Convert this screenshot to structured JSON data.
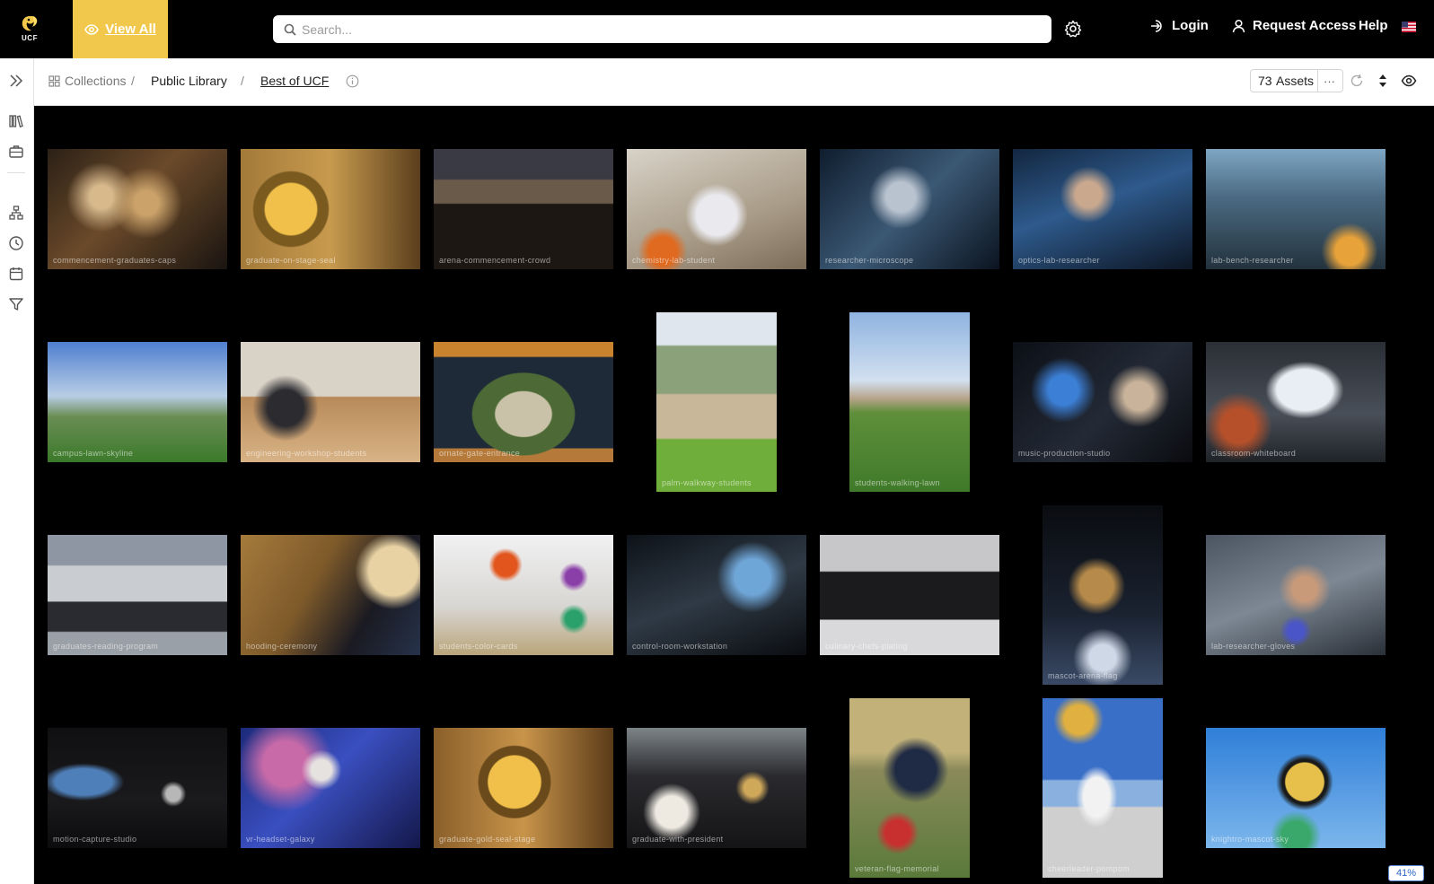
{
  "brand": {
    "logo_text": "UCF"
  },
  "topbar": {
    "view_all": "View All",
    "search_placeholder": "Search...",
    "login": "Login",
    "request_access": "Request Access",
    "help": "Help"
  },
  "breadcrumb": {
    "collections": "Collections",
    "sep1": "/",
    "public_library": "Public Library",
    "sep2": "/",
    "current": "Best of UCF"
  },
  "toolbar": {
    "asset_count": "73",
    "assets_label": "Assets",
    "more": "···"
  },
  "zoom_level": "41%",
  "colors": {
    "accent": "#f1c84b",
    "background": "#000000",
    "zoom_border": "#5b8ad6"
  },
  "photos": [
    {
      "name": "commencement-graduates-caps"
    },
    {
      "name": "graduate-on-stage-seal"
    },
    {
      "name": "arena-commencement-crowd"
    },
    {
      "name": "chemistry-lab-student"
    },
    {
      "name": "researcher-microscope"
    },
    {
      "name": "optics-lab-researcher"
    },
    {
      "name": "lab-bench-researcher"
    },
    {
      "name": "campus-lawn-skyline"
    },
    {
      "name": "engineering-workshop-students"
    },
    {
      "name": "ornate-gate-entrance"
    },
    {
      "name": "palm-walkway-students"
    },
    {
      "name": "students-walking-lawn"
    },
    {
      "name": "music-production-studio"
    },
    {
      "name": "classroom-whiteboard"
    },
    {
      "name": "graduates-reading-program"
    },
    {
      "name": "hooding-ceremony"
    },
    {
      "name": "students-color-cards"
    },
    {
      "name": "control-room-workstation"
    },
    {
      "name": "culinary-chefs-plating"
    },
    {
      "name": "mascot-arena-flag"
    },
    {
      "name": "lab-researcher-gloves"
    },
    {
      "name": "motion-capture-studio"
    },
    {
      "name": "vr-headset-galaxy"
    },
    {
      "name": "graduate-gold-seal-stage"
    },
    {
      "name": "graduate-with-president"
    },
    {
      "name": "veteran-flag-memorial"
    },
    {
      "name": "cheerleader-pompom"
    },
    {
      "name": "knightro-mascot-sky"
    }
  ]
}
